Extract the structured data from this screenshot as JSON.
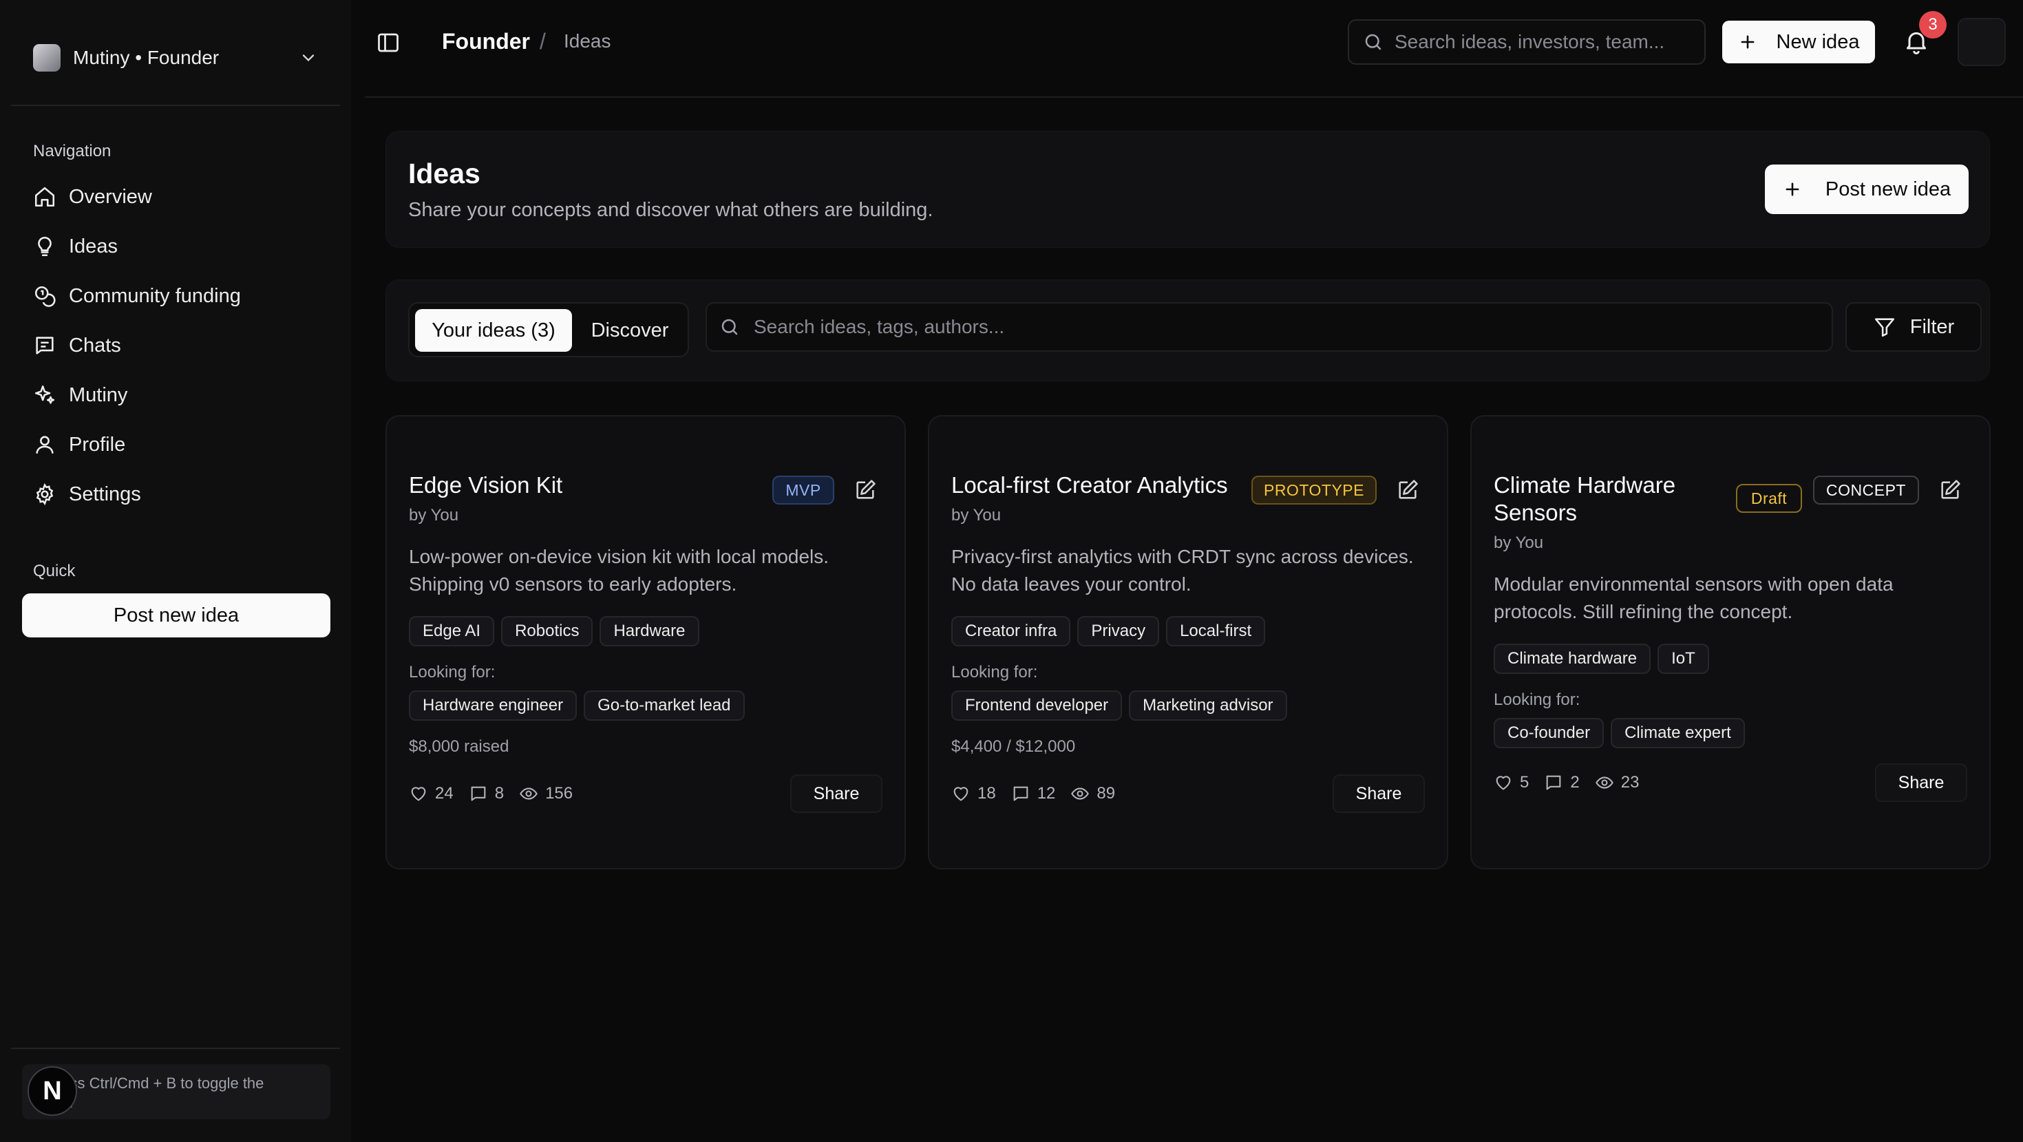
{
  "app": {
    "workspace": "Mutiny • Founder"
  },
  "sidebar": {
    "navigation_label": "Navigation",
    "items": [
      {
        "label": "Overview",
        "icon": "home-icon"
      },
      {
        "label": "Ideas",
        "icon": "lightbulb-icon"
      },
      {
        "label": "Community funding",
        "icon": "coins-icon"
      },
      {
        "label": "Chats",
        "icon": "chat-icon"
      },
      {
        "label": "Mutiny",
        "icon": "sparkles-icon"
      },
      {
        "label": "Profile",
        "icon": "user-icon"
      },
      {
        "label": "Settings",
        "icon": "gear-icon"
      }
    ],
    "quick_label": "Quick",
    "post_new_idea": "Post new idea",
    "hint": "ress Ctrl/Cmd + B to toggle the\nar.",
    "logo_letter": "N"
  },
  "topbar": {
    "breadcrumb_root": "Founder",
    "breadcrumb_sep": "/",
    "breadcrumb_current": "Ideas",
    "search_placeholder": "Search ideas, investors, team...",
    "new_idea": "New idea",
    "notification_count": "3"
  },
  "header": {
    "title": "Ideas",
    "subtitle": "Share your concepts and discover what others are building.",
    "post_button": "Post new idea"
  },
  "filters": {
    "tab_yours": "Your ideas (3)",
    "tab_discover": "Discover",
    "search_placeholder": "Search ideas, tags, authors...",
    "filter_button": "Filter"
  },
  "cards": [
    {
      "title": "Edge Vision Kit",
      "by": "by You",
      "stage": "MVP",
      "description": "Low-power on-device vision kit with local models. Shipping v0 sensors to early adopters.",
      "tags": [
        "Edge AI",
        "Robotics",
        "Hardware"
      ],
      "looking_for_label": "Looking for:",
      "looking_for": [
        "Hardware engineer",
        "Go-to-market lead"
      ],
      "funding": "$8,000 raised",
      "likes": "24",
      "comments": "8",
      "views": "156",
      "share": "Share"
    },
    {
      "title": "Local-first Creator Analytics",
      "by": "by You",
      "stage": "PROTOTYPE",
      "description": "Privacy-first analytics with CRDT sync across devices. No data leaves your control.",
      "tags": [
        "Creator infra",
        "Privacy",
        "Local-first"
      ],
      "looking_for_label": "Looking for:",
      "looking_for": [
        "Frontend developer",
        "Marketing advisor"
      ],
      "funding": "$4,400 / $12,000",
      "likes": "18",
      "comments": "12",
      "views": "89",
      "share": "Share"
    },
    {
      "title": "Climate Hardware Sensors",
      "by": "by You",
      "status": "Draft",
      "stage": "CONCEPT",
      "description": "Modular environmental sensors with open data protocols. Still refining the concept.",
      "tags": [
        "Climate hardware",
        "IoT"
      ],
      "looking_for_label": "Looking for:",
      "looking_for": [
        "Co-founder",
        "Climate expert"
      ],
      "likes": "5",
      "comments": "2",
      "views": "23",
      "share": "Share"
    }
  ],
  "colors": {
    "background": "#0a0a0b",
    "mvp": "#93b4f5",
    "prototype": "#f5c542",
    "draft": "#f5c542",
    "notification": "#e5484d"
  }
}
